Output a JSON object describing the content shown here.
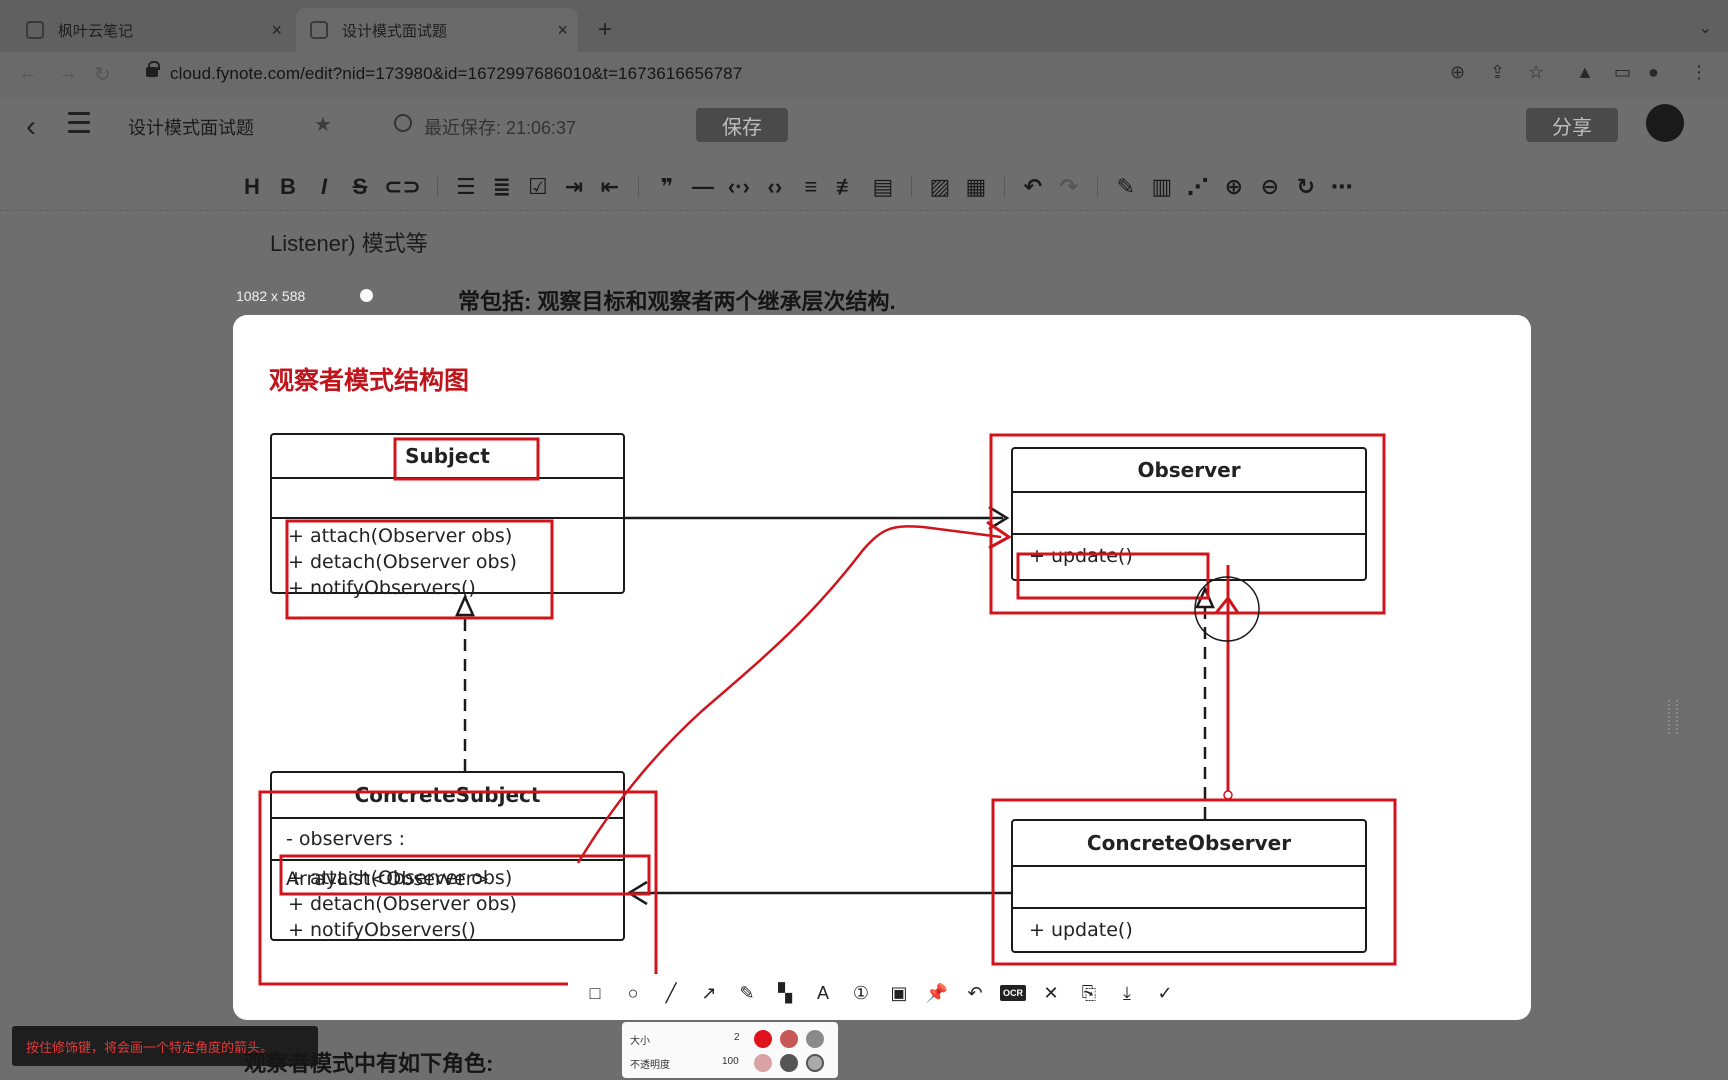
{
  "browser": {
    "tabs": [
      {
        "title": "枫叶云笔记",
        "active": false
      },
      {
        "title": "设计模式面试题",
        "active": true
      }
    ],
    "new_tab": "+",
    "url": "cloud.fynote.com/edit?nid=173980&id=1672997686010&t=1673616656787"
  },
  "app": {
    "doc_title": "设计模式面试题",
    "saved_text": "最近保存: 21:06:37",
    "save_label": "保存",
    "share_label": "分享"
  },
  "document": {
    "line_top": "Listener) 模式等",
    "line_bold": "常包括: 观察目标和观察者两个继承层次结构.",
    "line_bottom": "观察者模式中有如下角色:",
    "image_size": "1082 x 588"
  },
  "diagram": {
    "title": "观察者模式结构图",
    "classes": {
      "subject": {
        "name": "Subject",
        "ops": [
          "+ attach(Observer obs)",
          "+ detach(Observer obs)",
          "+ notifyObservers()"
        ]
      },
      "observer": {
        "name": "Observer",
        "ops": [
          "+ update()"
        ]
      },
      "concrete_subject": {
        "name": "ConcreteSubject",
        "attr": "- observers : ArrayList<Observer>",
        "ops": [
          "+ attach(Observer obs)",
          "+ detach(Observer obs)",
          "+ notifyObservers()"
        ]
      },
      "concrete_observer": {
        "name": "ConcreteObserver",
        "ops": [
          "+ update()"
        ]
      }
    },
    "annotation_color": "#d0141c"
  },
  "annotation_toolbar": {
    "size_label": "大小",
    "size_value": "2",
    "opacity_label": "不透明度",
    "opacity_value": "100",
    "ocr_label": "OCR",
    "swatches": [
      "#e0121b",
      "#c85858",
      "#8a8a8a"
    ]
  },
  "hint": "按住修饰键，将会画一个特定角度的箭头。"
}
